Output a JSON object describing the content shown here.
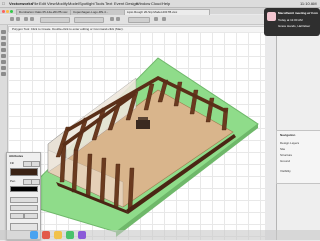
{
  "menubar": {
    "items": [
      "Vectorworks",
      "File",
      "Edit",
      "View",
      "Modify",
      "Model",
      "Spotlight",
      "Tools",
      "Text",
      "Event Design",
      "Window",
      "Cloud",
      "Help"
    ],
    "clock": "11:10 AM"
  },
  "tabs": [
    "Dumbarton Oaks 05-14a-2017B.vwx",
    "Copenhagen-Logo-RN-4...",
    "Lipio Rough 20-Sip Model-2017B.vwx"
  ],
  "helpbar": {
    "text": "Polygon Tool: Click to Create. Double-click to enter editing or Command-click (Mac)."
  },
  "attributes": {
    "title": "Attributes",
    "fill_label": "Fill",
    "pen_label": "Pen",
    "fill_color": "#3a2214",
    "pen_color": "#000000"
  },
  "notification": {
    "title": "MacoRemit meeting w/ Commerce.db",
    "line2": "Today at 11:00 AM",
    "line3": "Grace Hands, Hall Elser"
  },
  "navigation": {
    "title": "Navigation",
    "rows": [
      "Design Layers",
      "Site",
      "Structure",
      "Ground"
    ],
    "section": "Visibility"
  },
  "colors": {
    "ground": "#8fdc8a",
    "ground_edge": "#6fb86a",
    "timber": "#6a3a1f",
    "timber_dark": "#4a2614",
    "floor": "#d9b58c",
    "wall": "#e8e1d6"
  }
}
